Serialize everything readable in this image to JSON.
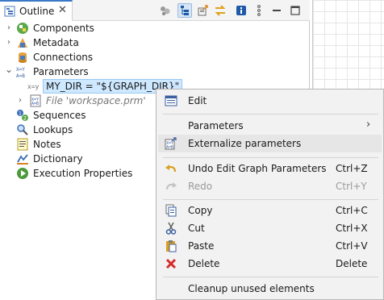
{
  "outline": {
    "tab_title": "Outline",
    "close_glyph": "✕",
    "toolbar": [
      {
        "name": "filter-icon",
        "pressed": false
      },
      {
        "name": "tree-layout-icon",
        "pressed": true
      },
      {
        "name": "export-icon",
        "pressed": false
      },
      {
        "name": "sync-icon",
        "pressed": false
      },
      {
        "name": "info-icon",
        "pressed": false
      },
      {
        "name": "view-menu-icon",
        "pressed": false
      },
      {
        "name": "minimize-icon",
        "pressed": false
      },
      {
        "name": "maximize-icon",
        "pressed": false
      }
    ],
    "tree": [
      {
        "label": "Components",
        "icon": "components-icon",
        "twisty": "›"
      },
      {
        "label": "Metadata",
        "icon": "metadata-icon",
        "twisty": "›"
      },
      {
        "label": "Connections",
        "icon": "connections-icon",
        "twisty": ""
      },
      {
        "label": "Parameters",
        "icon": "parameters-icon",
        "twisty": "⌄"
      },
      {
        "label": "MY_DIR = \"${GRAPH_DIR}\"",
        "icon": "parameter-icon",
        "twisty": "",
        "selected": true
      },
      {
        "label": "File 'workspace.prm'",
        "icon": "parameter-file-icon",
        "twisty": "›",
        "italic": true
      },
      {
        "label": "Sequences",
        "icon": "sequences-icon",
        "twisty": ""
      },
      {
        "label": "Lookups",
        "icon": "lookups-icon",
        "twisty": ""
      },
      {
        "label": "Notes",
        "icon": "notes-icon",
        "twisty": ""
      },
      {
        "label": "Dictionary",
        "icon": "dictionary-icon",
        "twisty": ""
      },
      {
        "label": "Execution Properties",
        "icon": "execution-properties-icon",
        "twisty": ""
      }
    ]
  },
  "context_menu": {
    "items": [
      {
        "label": "Edit",
        "shortcut": "",
        "icon": "edit-icon",
        "disabled": false
      },
      {
        "label": "Parameters",
        "shortcut": "",
        "icon": "",
        "submenu": "›",
        "disabled": false
      },
      {
        "label": "Externalize parameters",
        "shortcut": "",
        "icon": "externalize-icon",
        "disabled": false,
        "highlight": true
      },
      {
        "label": "Undo Edit Graph Parameters",
        "shortcut": "Ctrl+Z",
        "icon": "undo-icon",
        "disabled": false
      },
      {
        "label": "Redo",
        "shortcut": "Ctrl+Y",
        "icon": "redo-icon",
        "disabled": true
      },
      {
        "label": "Copy",
        "shortcut": "Ctrl+C",
        "icon": "copy-icon",
        "disabled": false
      },
      {
        "label": "Cut",
        "shortcut": "Ctrl+X",
        "icon": "cut-icon",
        "disabled": false
      },
      {
        "label": "Paste",
        "shortcut": "Ctrl+V",
        "icon": "paste-icon",
        "disabled": false
      },
      {
        "label": "Delete",
        "shortcut": "Delete",
        "icon": "delete-icon",
        "disabled": false
      },
      {
        "label": "Cleanup unused elements",
        "shortcut": "",
        "icon": "",
        "disabled": false
      }
    ]
  }
}
